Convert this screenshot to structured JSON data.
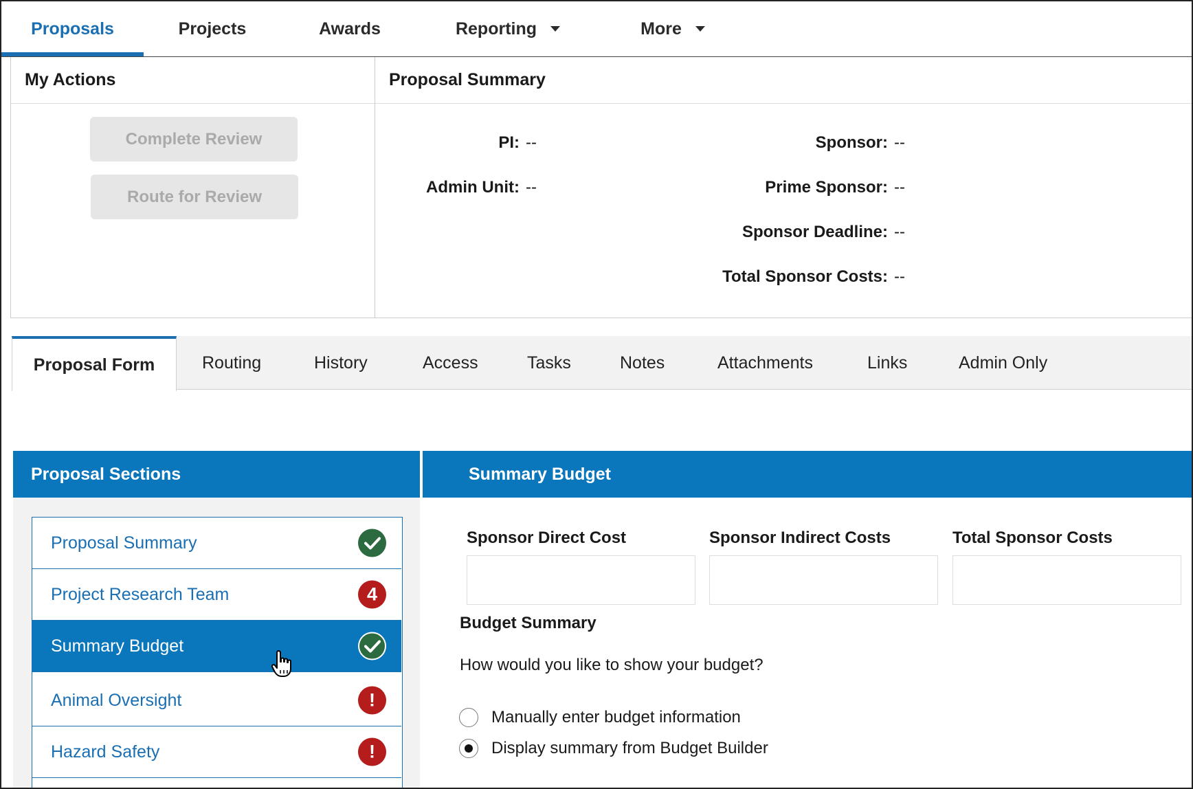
{
  "top_nav": {
    "items": [
      {
        "label": "Proposals",
        "active": true
      },
      {
        "label": "Projects"
      },
      {
        "label": "Awards"
      },
      {
        "label": "Reporting",
        "dropdown": true
      },
      {
        "label": "More",
        "dropdown": true
      }
    ]
  },
  "my_actions": {
    "title": "My Actions",
    "complete_review": "Complete Review",
    "route_for_review": "Route for Review"
  },
  "proposal_summary": {
    "title": "Proposal Summary",
    "pi_label": "PI:",
    "pi_value": "--",
    "admin_unit_label": "Admin Unit:",
    "admin_unit_value": "--",
    "sponsor_label": "Sponsor:",
    "sponsor_value": "--",
    "prime_sponsor_label": "Prime Sponsor:",
    "prime_sponsor_value": "--",
    "sponsor_deadline_label": "Sponsor Deadline:",
    "sponsor_deadline_value": "--",
    "total_sponsor_costs_label": "Total Sponsor Costs:",
    "total_sponsor_costs_value": "--"
  },
  "tabs": [
    {
      "label": "Proposal Form",
      "active": true
    },
    {
      "label": "Routing"
    },
    {
      "label": "History"
    },
    {
      "label": "Access"
    },
    {
      "label": "Tasks"
    },
    {
      "label": "Notes"
    },
    {
      "label": "Attachments"
    },
    {
      "label": "Links"
    },
    {
      "label": "Admin Only"
    }
  ],
  "sections": {
    "title": "Proposal Sections",
    "items": [
      {
        "label": "Proposal Summary",
        "status": "complete",
        "icon": "check-icon"
      },
      {
        "label": "Project Research Team",
        "status": "errors",
        "badge": "4"
      },
      {
        "label": "Summary Budget",
        "status": "complete",
        "selected": true,
        "icon": "check-icon"
      },
      {
        "label": "Animal Oversight",
        "status": "error",
        "badge": "!"
      },
      {
        "label": "Hazard Safety",
        "status": "error",
        "badge": "!"
      }
    ]
  },
  "summary_budget": {
    "title": "Summary Budget",
    "direct_cost_label": "Sponsor Direct Cost",
    "indirect_costs_label": "Sponsor Indirect Costs",
    "total_costs_label": "Total Sponsor Costs",
    "direct_cost_value": "",
    "indirect_costs_value": "",
    "total_costs_value": "",
    "budget_summary_heading": "Budget Summary",
    "question": "How would you like to show your budget?",
    "options": [
      {
        "label": "Manually enter budget information",
        "checked": false
      },
      {
        "label": "Display summary from Budget Builder",
        "checked": true
      }
    ]
  },
  "colors": {
    "brand_blue": "#0a76bb",
    "success_green": "#2c6a3f",
    "error_red": "#b51c1c"
  }
}
